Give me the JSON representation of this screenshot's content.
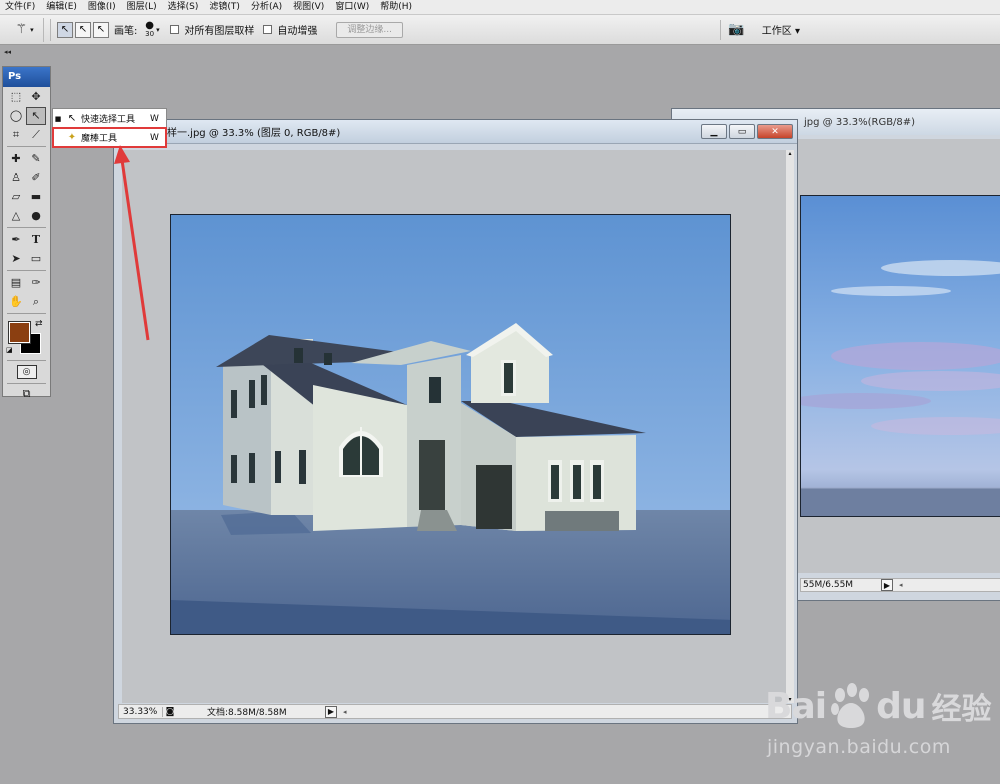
{
  "menubar": {
    "items": [
      {
        "label": "文件(F)"
      },
      {
        "label": "编辑(E)"
      },
      {
        "label": "图像(I)"
      },
      {
        "label": "图层(L)"
      },
      {
        "label": "选择(S)"
      },
      {
        "label": "滤镜(T)"
      },
      {
        "label": "分析(A)"
      },
      {
        "label": "视图(V)"
      },
      {
        "label": "窗口(W)"
      },
      {
        "label": "帮助(H)"
      }
    ]
  },
  "options": {
    "brush_label": "画笔:",
    "brush_size": "30",
    "sample_all_layers": "对所有图层取样",
    "auto_enhance": "自动增强",
    "refine_edge": "调整边缘...",
    "workspace": "工作区 ▾"
  },
  "toolbox": {
    "header": "Ps",
    "collapse": "◂◂"
  },
  "flyout": {
    "items": [
      {
        "label": "快速选择工具",
        "shortcut": "W",
        "icon": "quick-selection-icon"
      },
      {
        "label": "魔棒工具",
        "shortcut": "W",
        "icon": "magic-wand-icon"
      }
    ]
  },
  "colors": {
    "foreground": "#8b3f11",
    "background": "#000000",
    "highlight": "#e03a3a"
  },
  "document": {
    "title": "样一.jpg @ 33.3% (图层 0, RGB/8#)",
    "zoom": "33.33%",
    "doc_size": "文档:8.58M/8.58M"
  },
  "document2": {
    "title": "jpg @ 33.3%(RGB/8#)",
    "doc_size": "55M/6.55M"
  },
  "watermark": {
    "brand": "Bai",
    "brand2": "du",
    "product": "经验",
    "url": "jingyan.baidu.com"
  }
}
